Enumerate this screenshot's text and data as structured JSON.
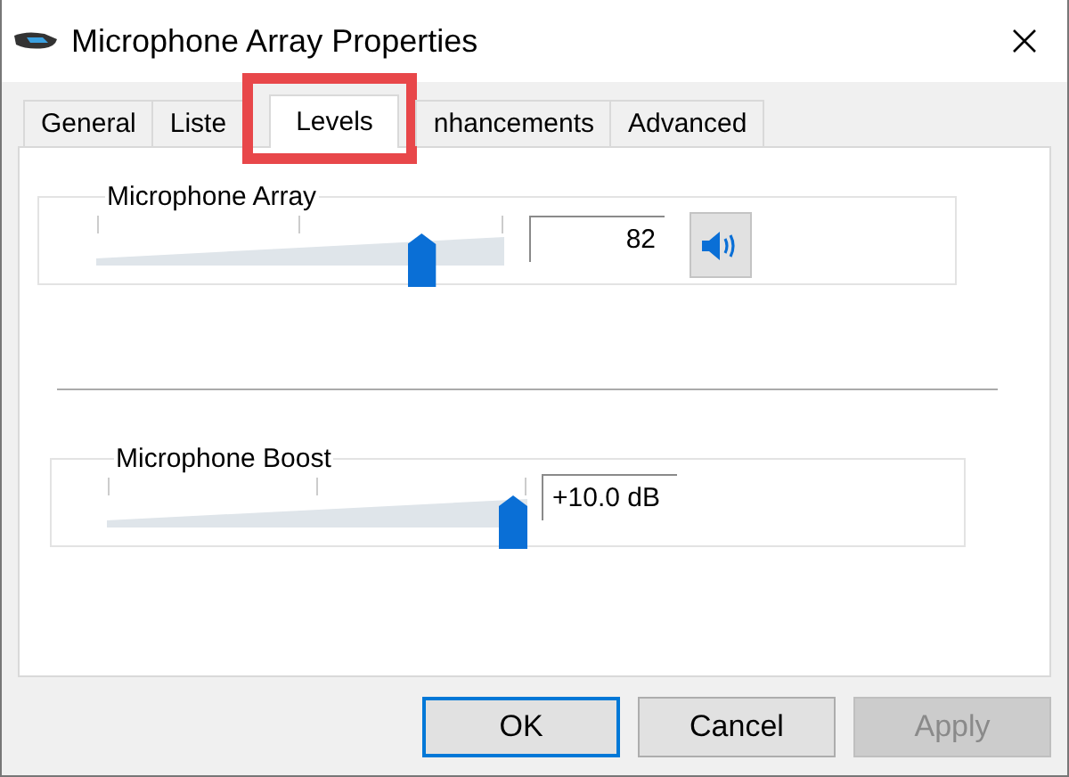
{
  "window": {
    "title": "Microphone Array Properties"
  },
  "tabs": [
    {
      "label": "General",
      "selected": false,
      "highlighted": false
    },
    {
      "label": "Liste",
      "selected": false,
      "highlighted": false
    },
    {
      "label": "Levels",
      "selected": true,
      "highlighted": true
    },
    {
      "label": "nhancements",
      "selected": false,
      "highlighted": false
    },
    {
      "label": "Advanced",
      "selected": false,
      "highlighted": false
    }
  ],
  "levels": [
    {
      "kind": "volume",
      "label": "Microphone Array",
      "level": 0.82,
      "reading": "82",
      "muted": false
    },
    {
      "kind": "boost",
      "label": "Microphone Boost",
      "level": 1,
      "reading": "+10.0 dB"
    }
  ],
  "buttons": [
    {
      "label": "OK",
      "default": true,
      "disabled": false
    },
    {
      "label": "Cancel",
      "default": false,
      "disabled": false
    },
    {
      "label": "Apply",
      "default": false,
      "disabled": true
    }
  ]
}
